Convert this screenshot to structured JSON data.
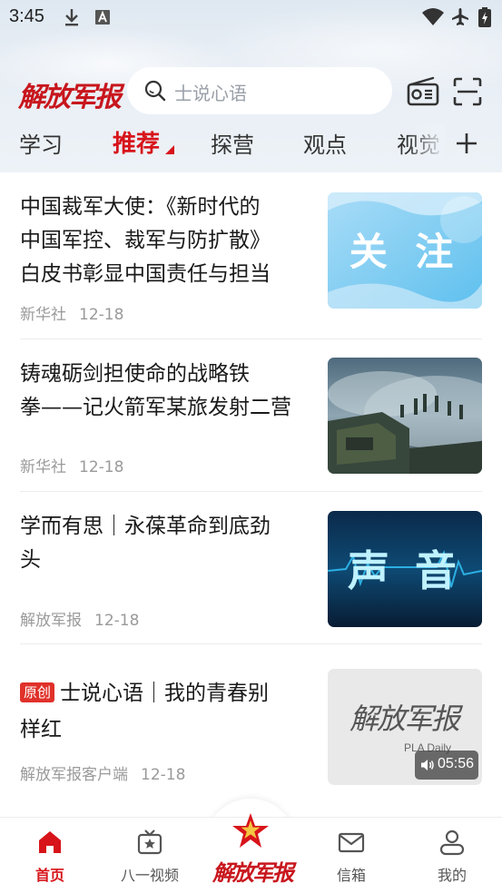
{
  "status_bar": {
    "time": "3:45"
  },
  "header": {
    "logo_text": "解放军报",
    "search_placeholder": "士说心语"
  },
  "tabs": [
    {
      "label": "学习"
    },
    {
      "label": "推荐"
    },
    {
      "label": "探营"
    },
    {
      "label": "观点"
    },
    {
      "label": "视觉"
    }
  ],
  "articles": [
    {
      "title_lines": [
        "中国裁军大使：《新时代的",
        "中国军控、裁军与防扩散》",
        "白皮书彰显中国责任与担当"
      ],
      "source": "新华社",
      "date": "12-18",
      "thumb_text": "关 注"
    },
    {
      "title_lines": [
        "铸魂砺剑担使命的战略铁",
        "拳——记火箭军某旅发射二营"
      ],
      "source": "新华社",
      "date": "12-18"
    },
    {
      "title_lines": [
        "学而有思｜永葆革命到底劲",
        "头"
      ],
      "source": "解放军报",
      "date": "12-18",
      "thumb_text": "声 音"
    },
    {
      "badge": "原创",
      "title_lines": [
        "士说心语｜我的青春别",
        "样红"
      ],
      "source": "解放军报客户端",
      "date": "12-18",
      "thumb_logo": "解放军报",
      "thumb_sub": "PLA Daily",
      "duration": "05:56"
    }
  ],
  "bottom_nav": [
    {
      "label": "首页",
      "icon": "home-icon"
    },
    {
      "label": "八一视频",
      "icon": "tv-icon"
    },
    {
      "label": "解放军报",
      "icon": "star-icon"
    },
    {
      "label": "信箱",
      "icon": "mail-icon"
    },
    {
      "label": "我的",
      "icon": "user-icon"
    }
  ],
  "colors": {
    "accent": "#d7141a",
    "badge": "#e0312a"
  }
}
